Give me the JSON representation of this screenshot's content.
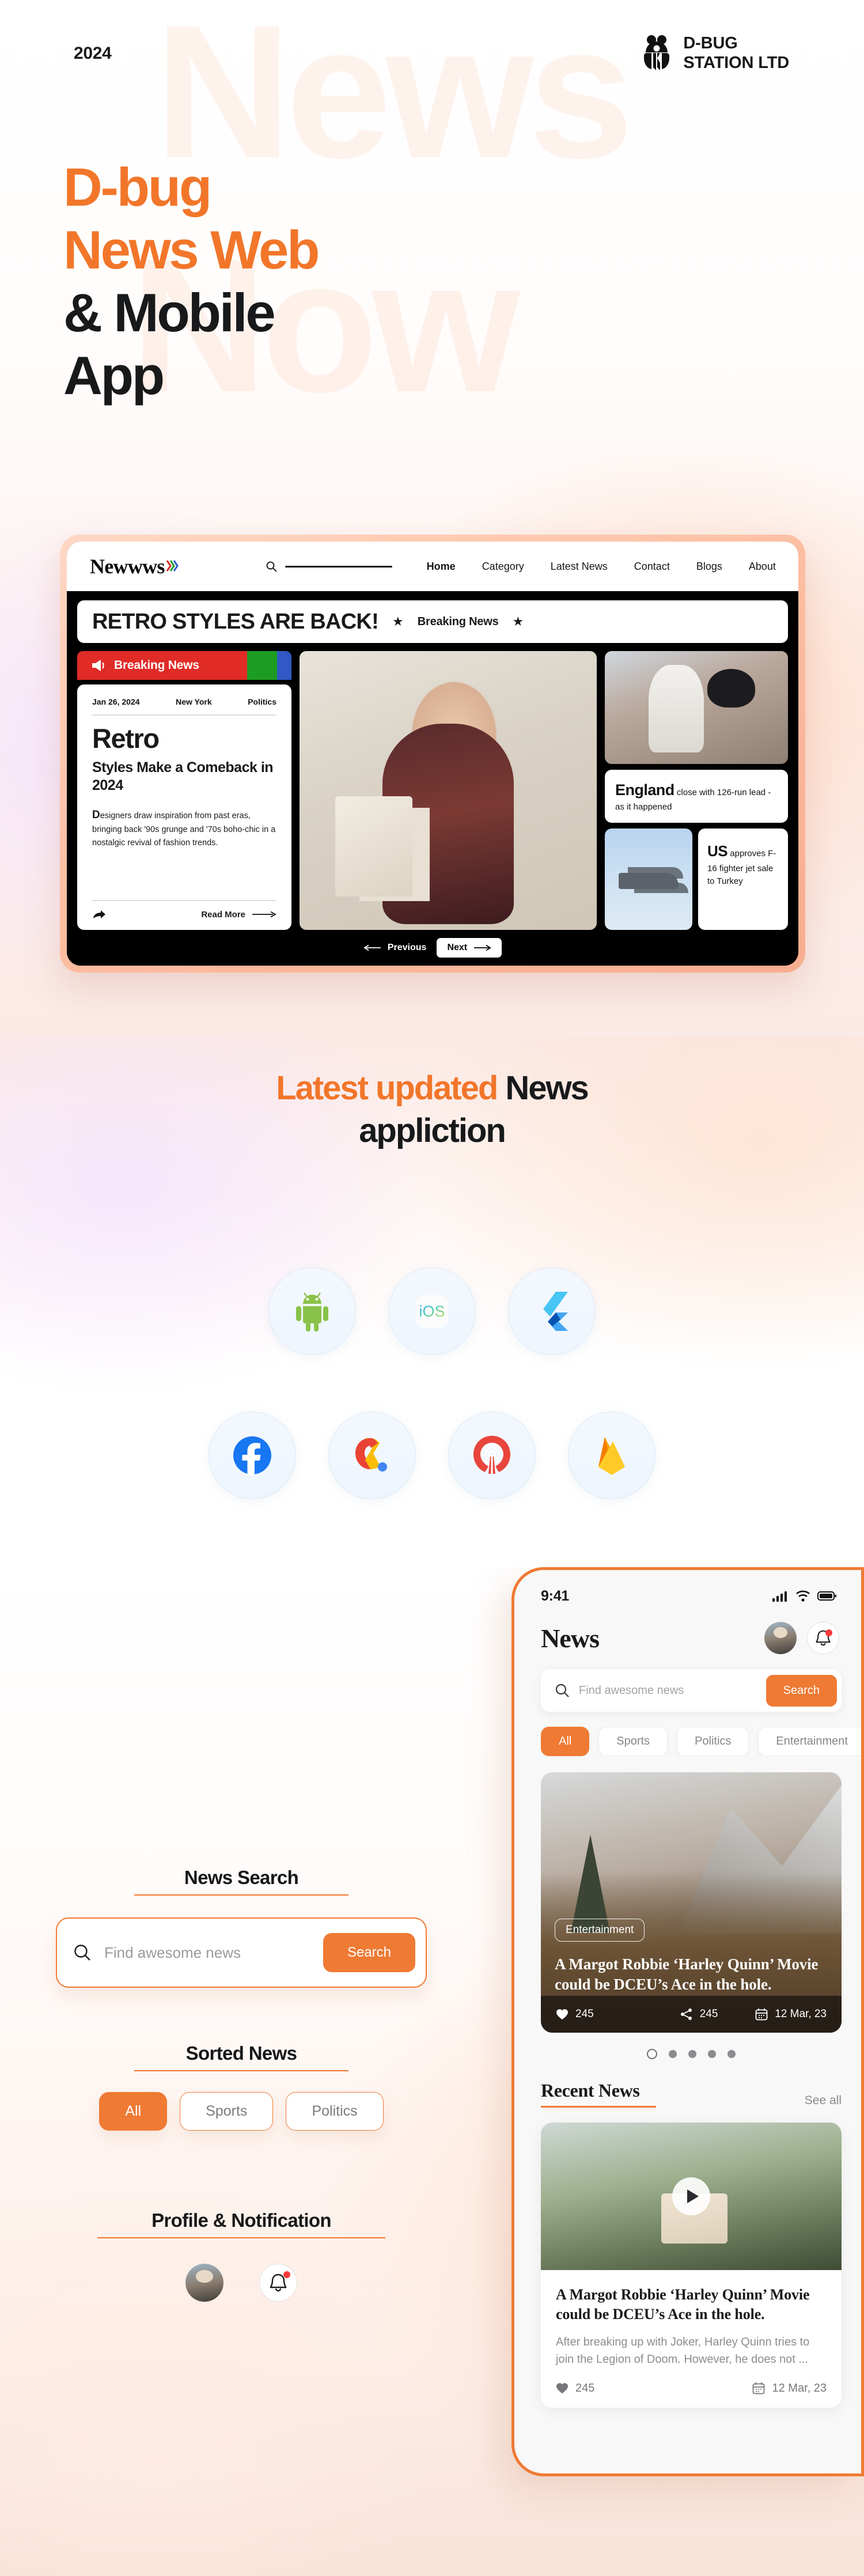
{
  "hero": {
    "year": "2024",
    "brand_name": "D-BUG\nSTATION LTD",
    "brand_icon": "bug-logo-icon",
    "watermark_line1": "News",
    "watermark_line2": "Now",
    "title_line1": "D-bug",
    "title_line2": "News Web",
    "title_line3": "& Mobile",
    "title_line4": "App"
  },
  "browser": {
    "logo": "Newwws",
    "logo_waves": ")))",
    "search_icon": "search-icon",
    "nav_links": [
      "Home",
      "Category",
      "Latest News",
      "Contact",
      "Blogs",
      "About"
    ],
    "headline": "RETRO STYLES ARE BACK!",
    "breaking_label": "Breaking News",
    "star_glyph": "★",
    "breaking_strip_label": "Breaking News",
    "card": {
      "date": "Jan 26, 2024",
      "location": "New York",
      "category": "Politics",
      "kicker": "Retro",
      "subtitle": "Styles Make a Comeback in 2024",
      "body_dropcap": "D",
      "body": "esigners draw inspiration from past eras, bringing back '90s grunge and '70s boho-chic in a nostalgic revival of fashion trends.",
      "read_more": "Read More",
      "share_icon": "share-arrow-icon"
    },
    "side_card_1": {
      "bold": "England",
      "rest": "close with 126-run lead - as it happened"
    },
    "side_card_2": {
      "bold": "US",
      "rest": "approves F-16 fighter jet sale to Turkey"
    },
    "pager": {
      "previous": "Previous",
      "next": "Next"
    }
  },
  "platforms": {
    "title_orange": "Latest updated",
    "title_dark": " News",
    "title_line2": "appliction",
    "icons_row1": [
      {
        "name": "android-icon",
        "label": "Android"
      },
      {
        "name": "ios-icon",
        "label": "iOS"
      },
      {
        "name": "flutter-icon",
        "label": "Flutter"
      }
    ],
    "icons_row2": [
      {
        "name": "facebook-icon",
        "label": "Facebook"
      },
      {
        "name": "admob-icon",
        "label": "AdMob"
      },
      {
        "name": "broadcast-icon",
        "label": "Broadcast"
      },
      {
        "name": "firebase-icon",
        "label": "Firebase"
      }
    ]
  },
  "features": {
    "news_search": {
      "title": "News Search",
      "placeholder": "Find awesome news",
      "button": "Search",
      "search_icon": "search-icon"
    },
    "sorted_news": {
      "title": "Sorted News",
      "chips": [
        "All",
        "Sports",
        "Politics"
      ],
      "active_chip": "All"
    },
    "profile_notification": {
      "title": "Profile & Notification",
      "avatar_icon": "avatar-icon",
      "bell_icon": "bell-icon"
    }
  },
  "phone": {
    "status_time": "9:41",
    "status_icons": [
      "cellular-signal-icon",
      "wifi-icon",
      "battery-icon"
    ],
    "app_title": "News",
    "avatar_icon": "avatar-icon",
    "bell_icon": "bell-icon",
    "search": {
      "placeholder": "Find awesome news",
      "button": "Search",
      "search_icon": "search-icon"
    },
    "chips": [
      "All",
      "Sports",
      "Politics",
      "Entertainment"
    ],
    "active_chip": "All",
    "hero_card": {
      "tag": "Entertainment",
      "title": "A Margot Robbie ‘Harley Quinn’ Movie could be DCEU’s Ace in the hole.",
      "likes": "245",
      "shares": "245",
      "date": "12 Mar, 23",
      "like_icon": "heart-icon",
      "share_icon": "share-icon",
      "date_icon": "calendar-icon"
    },
    "carousel_dots": 5,
    "carousel_active_index": 0,
    "recent": {
      "title": "Recent News",
      "see_all": "See all"
    },
    "recent_card": {
      "title": "A Margot Robbie ‘Harley Quinn’ Movie could be DCEU’s Ace in the hole.",
      "description": "After breaking up with Joker, Harley Quinn tries to join the Legion of Doom. However, he does not ...",
      "likes": "245",
      "date": "12 Mar, 23",
      "play_icon": "play-icon",
      "like_icon": "heart-icon",
      "date_icon": "calendar-icon"
    }
  },
  "colors": {
    "accent": "#ef7a34",
    "accent_title": "#f2762a",
    "dark": "#18191b",
    "breaking_red": "#e02b27",
    "breaking_green": "#1d9c22",
    "breaking_blue": "#3158c4",
    "notification_dot": "#f63b3b"
  }
}
